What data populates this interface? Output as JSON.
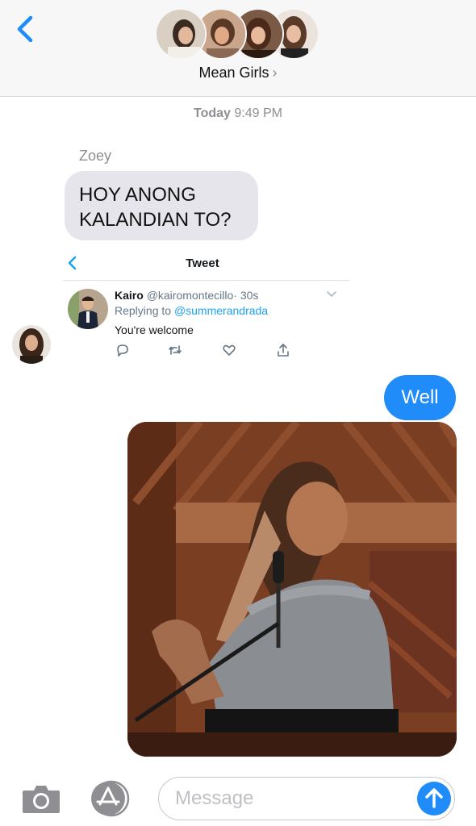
{
  "header": {
    "group_name": "Mean Girls",
    "chevron": "›"
  },
  "conversation": {
    "timestamp_day": "Today",
    "timestamp_time": "9:49 PM",
    "incoming": {
      "sender": "Zoey",
      "text_line1": "HOY ANONG",
      "text_line2": "KALANDIAN TO?"
    },
    "tweet": {
      "title": "Tweet",
      "author_name": "Kairo",
      "author_handle": "@kairomontecillo",
      "time_ago": "· 30s",
      "replying_prefix": "Replying to",
      "replying_handle": "@summerandrada",
      "text": "You're welcome"
    },
    "outgoing": {
      "text": "Well"
    }
  },
  "composer": {
    "placeholder": "Message"
  },
  "icons": {
    "back": "chevron-left-icon",
    "camera": "camera-icon",
    "appstore": "app-store-icon",
    "send": "arrow-up-icon",
    "reply": "reply-icon",
    "retweet": "retweet-icon",
    "like": "heart-icon",
    "share": "share-icon"
  },
  "colors": {
    "accent": "#1f8cf9",
    "incoming_bubble": "#e6e5eb",
    "twitter_blue": "#1da1f2"
  }
}
